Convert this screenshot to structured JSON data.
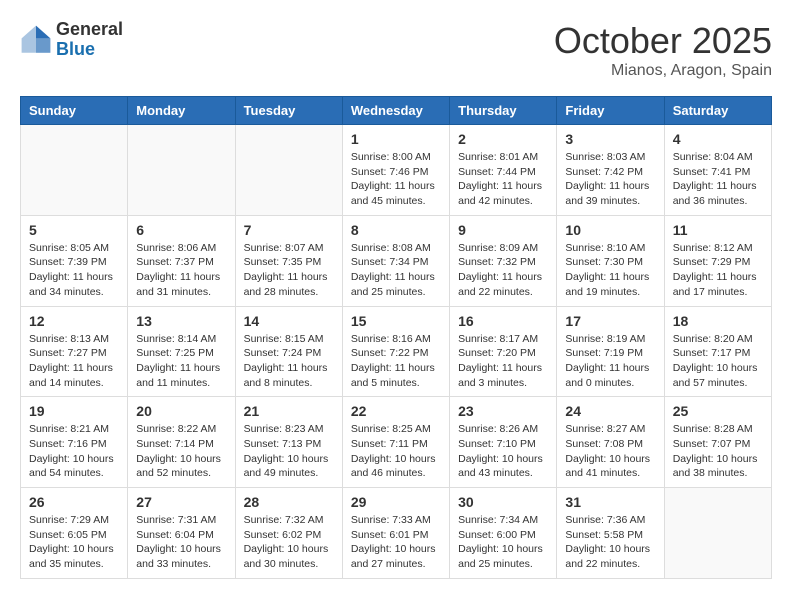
{
  "logo": {
    "general": "General",
    "blue": "Blue"
  },
  "header": {
    "month": "October 2025",
    "location": "Mianos, Aragon, Spain"
  },
  "weekdays": [
    "Sunday",
    "Monday",
    "Tuesday",
    "Wednesday",
    "Thursday",
    "Friday",
    "Saturday"
  ],
  "weeks": [
    [
      {
        "day": "",
        "info": ""
      },
      {
        "day": "",
        "info": ""
      },
      {
        "day": "",
        "info": ""
      },
      {
        "day": "1",
        "info": "Sunrise: 8:00 AM\nSunset: 7:46 PM\nDaylight: 11 hours\nand 45 minutes."
      },
      {
        "day": "2",
        "info": "Sunrise: 8:01 AM\nSunset: 7:44 PM\nDaylight: 11 hours\nand 42 minutes."
      },
      {
        "day": "3",
        "info": "Sunrise: 8:03 AM\nSunset: 7:42 PM\nDaylight: 11 hours\nand 39 minutes."
      },
      {
        "day": "4",
        "info": "Sunrise: 8:04 AM\nSunset: 7:41 PM\nDaylight: 11 hours\nand 36 minutes."
      }
    ],
    [
      {
        "day": "5",
        "info": "Sunrise: 8:05 AM\nSunset: 7:39 PM\nDaylight: 11 hours\nand 34 minutes."
      },
      {
        "day": "6",
        "info": "Sunrise: 8:06 AM\nSunset: 7:37 PM\nDaylight: 11 hours\nand 31 minutes."
      },
      {
        "day": "7",
        "info": "Sunrise: 8:07 AM\nSunset: 7:35 PM\nDaylight: 11 hours\nand 28 minutes."
      },
      {
        "day": "8",
        "info": "Sunrise: 8:08 AM\nSunset: 7:34 PM\nDaylight: 11 hours\nand 25 minutes."
      },
      {
        "day": "9",
        "info": "Sunrise: 8:09 AM\nSunset: 7:32 PM\nDaylight: 11 hours\nand 22 minutes."
      },
      {
        "day": "10",
        "info": "Sunrise: 8:10 AM\nSunset: 7:30 PM\nDaylight: 11 hours\nand 19 minutes."
      },
      {
        "day": "11",
        "info": "Sunrise: 8:12 AM\nSunset: 7:29 PM\nDaylight: 11 hours\nand 17 minutes."
      }
    ],
    [
      {
        "day": "12",
        "info": "Sunrise: 8:13 AM\nSunset: 7:27 PM\nDaylight: 11 hours\nand 14 minutes."
      },
      {
        "day": "13",
        "info": "Sunrise: 8:14 AM\nSunset: 7:25 PM\nDaylight: 11 hours\nand 11 minutes."
      },
      {
        "day": "14",
        "info": "Sunrise: 8:15 AM\nSunset: 7:24 PM\nDaylight: 11 hours\nand 8 minutes."
      },
      {
        "day": "15",
        "info": "Sunrise: 8:16 AM\nSunset: 7:22 PM\nDaylight: 11 hours\nand 5 minutes."
      },
      {
        "day": "16",
        "info": "Sunrise: 8:17 AM\nSunset: 7:20 PM\nDaylight: 11 hours\nand 3 minutes."
      },
      {
        "day": "17",
        "info": "Sunrise: 8:19 AM\nSunset: 7:19 PM\nDaylight: 11 hours\nand 0 minutes."
      },
      {
        "day": "18",
        "info": "Sunrise: 8:20 AM\nSunset: 7:17 PM\nDaylight: 10 hours\nand 57 minutes."
      }
    ],
    [
      {
        "day": "19",
        "info": "Sunrise: 8:21 AM\nSunset: 7:16 PM\nDaylight: 10 hours\nand 54 minutes."
      },
      {
        "day": "20",
        "info": "Sunrise: 8:22 AM\nSunset: 7:14 PM\nDaylight: 10 hours\nand 52 minutes."
      },
      {
        "day": "21",
        "info": "Sunrise: 8:23 AM\nSunset: 7:13 PM\nDaylight: 10 hours\nand 49 minutes."
      },
      {
        "day": "22",
        "info": "Sunrise: 8:25 AM\nSunset: 7:11 PM\nDaylight: 10 hours\nand 46 minutes."
      },
      {
        "day": "23",
        "info": "Sunrise: 8:26 AM\nSunset: 7:10 PM\nDaylight: 10 hours\nand 43 minutes."
      },
      {
        "day": "24",
        "info": "Sunrise: 8:27 AM\nSunset: 7:08 PM\nDaylight: 10 hours\nand 41 minutes."
      },
      {
        "day": "25",
        "info": "Sunrise: 8:28 AM\nSunset: 7:07 PM\nDaylight: 10 hours\nand 38 minutes."
      }
    ],
    [
      {
        "day": "26",
        "info": "Sunrise: 7:29 AM\nSunset: 6:05 PM\nDaylight: 10 hours\nand 35 minutes."
      },
      {
        "day": "27",
        "info": "Sunrise: 7:31 AM\nSunset: 6:04 PM\nDaylight: 10 hours\nand 33 minutes."
      },
      {
        "day": "28",
        "info": "Sunrise: 7:32 AM\nSunset: 6:02 PM\nDaylight: 10 hours\nand 30 minutes."
      },
      {
        "day": "29",
        "info": "Sunrise: 7:33 AM\nSunset: 6:01 PM\nDaylight: 10 hours\nand 27 minutes."
      },
      {
        "day": "30",
        "info": "Sunrise: 7:34 AM\nSunset: 6:00 PM\nDaylight: 10 hours\nand 25 minutes."
      },
      {
        "day": "31",
        "info": "Sunrise: 7:36 AM\nSunset: 5:58 PM\nDaylight: 10 hours\nand 22 minutes."
      },
      {
        "day": "",
        "info": ""
      }
    ]
  ]
}
